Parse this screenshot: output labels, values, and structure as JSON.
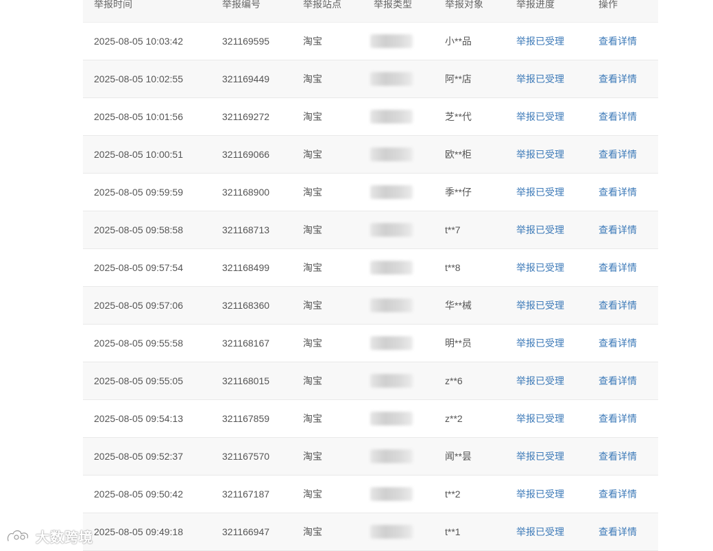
{
  "table": {
    "headers": {
      "time": "举报时间",
      "id": "举报编号",
      "site": "举报站点",
      "type": "举报类型",
      "target": "举报对象",
      "status": "举报进度",
      "action": "操作"
    },
    "rows": [
      {
        "time": "2025-08-05 10:03:42",
        "id": "321169595",
        "site": "淘宝",
        "target": "小**品",
        "status": "举报已受理",
        "action": "查看详情"
      },
      {
        "time": "2025-08-05 10:02:55",
        "id": "321169449",
        "site": "淘宝",
        "target": "阿**店",
        "status": "举报已受理",
        "action": "查看详情"
      },
      {
        "time": "2025-08-05 10:01:56",
        "id": "321169272",
        "site": "淘宝",
        "target": "芝**代",
        "status": "举报已受理",
        "action": "查看详情"
      },
      {
        "time": "2025-08-05 10:00:51",
        "id": "321169066",
        "site": "淘宝",
        "target": "欧**柜",
        "status": "举报已受理",
        "action": "查看详情"
      },
      {
        "time": "2025-08-05 09:59:59",
        "id": "321168900",
        "site": "淘宝",
        "target": "季**仔",
        "status": "举报已受理",
        "action": "查看详情"
      },
      {
        "time": "2025-08-05 09:58:58",
        "id": "321168713",
        "site": "淘宝",
        "target": "t**7",
        "status": "举报已受理",
        "action": "查看详情"
      },
      {
        "time": "2025-08-05 09:57:54",
        "id": "321168499",
        "site": "淘宝",
        "target": "t**8",
        "status": "举报已受理",
        "action": "查看详情"
      },
      {
        "time": "2025-08-05 09:57:06",
        "id": "321168360",
        "site": "淘宝",
        "target": "华**械",
        "status": "举报已受理",
        "action": "查看详情"
      },
      {
        "time": "2025-08-05 09:55:58",
        "id": "321168167",
        "site": "淘宝",
        "target": "明**员",
        "status": "举报已受理",
        "action": "查看详情"
      },
      {
        "time": "2025-08-05 09:55:05",
        "id": "321168015",
        "site": "淘宝",
        "target": "z**6",
        "status": "举报已受理",
        "action": "查看详情"
      },
      {
        "time": "2025-08-05 09:54:13",
        "id": "321167859",
        "site": "淘宝",
        "target": "z**2",
        "status": "举报已受理",
        "action": "查看详情"
      },
      {
        "time": "2025-08-05 09:52:37",
        "id": "321167570",
        "site": "淘宝",
        "target": "闻**昙",
        "status": "举报已受理",
        "action": "查看详情"
      },
      {
        "time": "2025-08-05 09:50:42",
        "id": "321167187",
        "site": "淘宝",
        "target": "t**2",
        "status": "举报已受理",
        "action": "查看详情"
      },
      {
        "time": "2025-08-05 09:49:18",
        "id": "321166947",
        "site": "淘宝",
        "target": "t**1",
        "status": "举报已受理",
        "action": "查看详情"
      }
    ]
  },
  "watermark": {
    "text": "大数跨境",
    "icon": "brand-logo-icon"
  },
  "colors": {
    "link": "#3d7ab8",
    "text": "#555555",
    "header_bg": "#f7f7f7",
    "alt_row_bg": "#f8f8f8"
  }
}
